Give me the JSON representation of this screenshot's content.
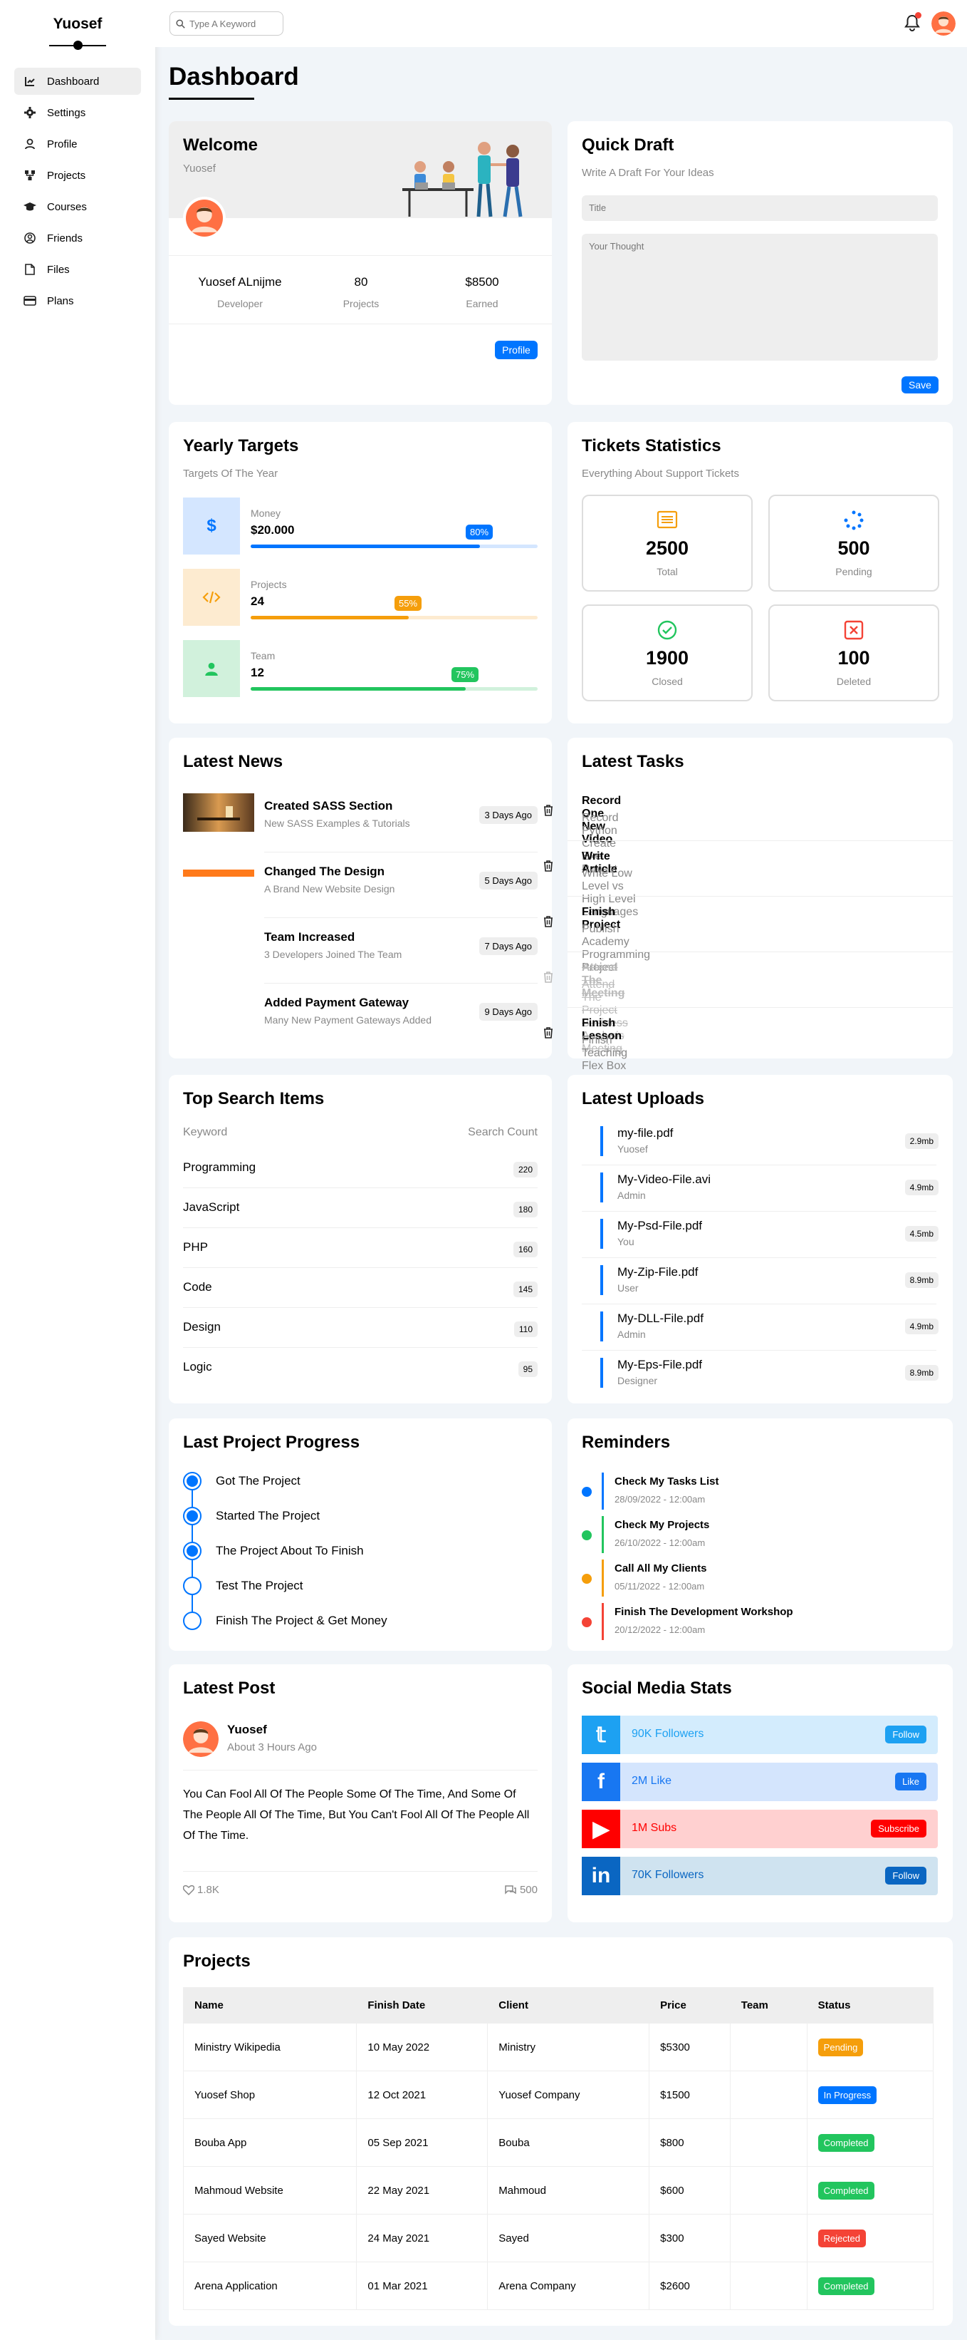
{
  "brand": "Yuosef",
  "nav": [
    {
      "label": "Dashboard",
      "icon": "chart-line-icon",
      "active": true
    },
    {
      "label": "Settings",
      "icon": "gear-icon"
    },
    {
      "label": "Profile",
      "icon": "user-icon"
    },
    {
      "label": "Projects",
      "icon": "diagram-icon"
    },
    {
      "label": "Courses",
      "icon": "graduation-cap-icon"
    },
    {
      "label": "Friends",
      "icon": "circle-user-icon"
    },
    {
      "label": "Files",
      "icon": "file-icon"
    },
    {
      "label": "Plans",
      "icon": "credit-card-icon"
    }
  ],
  "search": {
    "placeholder": "Type A Keyword"
  },
  "page_title": "Dashboard",
  "welcome": {
    "title": "Welcome",
    "name": "Yuosef",
    "stats": [
      {
        "value": "Yuosef ALnijme",
        "label": "Developer"
      },
      {
        "value": "80",
        "label": "Projects"
      },
      {
        "value": "$8500",
        "label": "Earned"
      }
    ],
    "button": "Profile"
  },
  "draft": {
    "title": "Quick Draft",
    "subtitle": "Write A Draft For Your Ideas",
    "title_placeholder": "Title",
    "body_placeholder": "Your  Thought",
    "button": "Save"
  },
  "targets": {
    "title": "Yearly Targets",
    "subtitle": "Targets Of The Year",
    "items": [
      {
        "label": "Money",
        "value": "$20.000",
        "percent": 80,
        "percent_label": "80%",
        "color": "#0075ff",
        "bg": "#d4e6ff",
        "icon": "dollar-icon"
      },
      {
        "label": "Projects",
        "value": "24",
        "percent": 55,
        "percent_label": "55%",
        "color": "#f59e0b",
        "bg": "#fdebd0",
        "icon": "code-icon"
      },
      {
        "label": "Team",
        "value": "12",
        "percent": 75,
        "percent_label": "75%",
        "color": "#22c55e",
        "bg": "#d1f1dc",
        "icon": "user-icon"
      }
    ]
  },
  "tickets": {
    "title": "Tickets Statistics",
    "subtitle": "Everything About Support Tickets",
    "items": [
      {
        "value": "2500",
        "label": "Total",
        "color": "#f59e0b",
        "icon": "list-icon"
      },
      {
        "value": "500",
        "label": "Pending",
        "color": "#0075ff",
        "icon": "spinner-icon"
      },
      {
        "value": "1900",
        "label": "Closed",
        "color": "#22c55e",
        "icon": "check-circle-icon"
      },
      {
        "value": "100",
        "label": "Deleted",
        "color": "#f44336",
        "icon": "x-square-icon"
      }
    ]
  },
  "news": {
    "title": "Latest News",
    "items": [
      {
        "title": "Created SASS Section",
        "desc": "New SASS Examples & Tutorials",
        "time": "3 Days Ago"
      },
      {
        "title": "Changed The Design",
        "desc": "A Brand New Website Design",
        "time": "5 Days Ago"
      },
      {
        "title": "Team Increased",
        "desc": "3 Developers Joined The Team",
        "time": "7 Days Ago"
      },
      {
        "title": "Added Payment Gateway",
        "desc": "Many New Payment Gateways Added",
        "time": "9 Days Ago"
      }
    ]
  },
  "tasks": {
    "title": "Latest Tasks",
    "items": [
      {
        "title": "Record One New Video",
        "desc": "Record Python Create Exe Project",
        "done": false
      },
      {
        "title": "Write Article",
        "desc": "Write Low Level vs High Level Languages",
        "done": false
      },
      {
        "title": "Finish Project",
        "desc": "Publish Academy Programming Project",
        "done": false
      },
      {
        "title": "Attend The Meeting",
        "desc": "Attend The Project Business Analysis Meeting",
        "done": true
      },
      {
        "title": "Finish Lesson",
        "desc": "Finish Teaching Flex Box",
        "done": false
      }
    ]
  },
  "top_search": {
    "title": "Top Search Items",
    "col_keyword": "Keyword",
    "col_count": "Search Count",
    "items": [
      {
        "keyword": "Programming",
        "count": "220"
      },
      {
        "keyword": "JavaScript",
        "count": "180"
      },
      {
        "keyword": "PHP",
        "count": "160"
      },
      {
        "keyword": "Code",
        "count": "145"
      },
      {
        "keyword": "Design",
        "count": "110"
      },
      {
        "keyword": "Logic",
        "count": "95"
      }
    ]
  },
  "uploads": {
    "title": "Latest Uploads",
    "items": [
      {
        "name": "my-file.pdf",
        "user": "Yuosef",
        "size": "2.9mb"
      },
      {
        "name": "My-Video-File.avi",
        "user": "Admin",
        "size": "4.9mb"
      },
      {
        "name": "My-Psd-File.pdf",
        "user": "You",
        "size": "4.5mb"
      },
      {
        "name": "My-Zip-File.pdf",
        "user": "User",
        "size": "8.9mb"
      },
      {
        "name": "My-DLL-File.pdf",
        "user": "Admin",
        "size": "4.9mb"
      },
      {
        "name": "My-Eps-File.pdf",
        "user": "Designer",
        "size": "8.9mb"
      }
    ]
  },
  "progress": {
    "title": "Last Project Progress",
    "steps": [
      {
        "label": "Got The Project",
        "done": true
      },
      {
        "label": "Started The Project",
        "done": true
      },
      {
        "label": "The Project About To Finish",
        "done": true
      },
      {
        "label": "Test The Project",
        "done": false
      },
      {
        "label": "Finish The Project & Get Money",
        "done": false
      }
    ]
  },
  "reminders": {
    "title": "Reminders",
    "items": [
      {
        "title": "Check My Tasks List",
        "date": "28/09/2022 - 12:00am",
        "color": "#0075ff"
      },
      {
        "title": "Check My Projects",
        "date": "26/10/2022 - 12:00am",
        "color": "#22c55e"
      },
      {
        "title": "Call All My Clients",
        "date": "05/11/2022 - 12:00am",
        "color": "#f59e0b"
      },
      {
        "title": "Finish The Development Workshop",
        "date": "20/12/2022 - 12:00am",
        "color": "#f44336"
      }
    ]
  },
  "post": {
    "title": "Latest Post",
    "author": "Yuosef",
    "time": "About 3 Hours Ago",
    "body": "You Can Fool All Of The People Some Of The Time, And Some Of The People All Of The Time, But You Can't Fool All Of The People All Of The Time.",
    "likes": "1.8K",
    "comments": "500"
  },
  "social": {
    "title": "Social Media Stats",
    "items": [
      {
        "text": "90K Followers",
        "button": "Follow",
        "color": "#1da1f2",
        "bg": "#d3ecfd",
        "icon": "twitter-icon",
        "glyph": "𝕥"
      },
      {
        "text": "2M Like",
        "button": "Like",
        "color": "#1877f2",
        "bg": "#d4e5fd",
        "icon": "facebook-icon",
        "glyph": "f"
      },
      {
        "text": "1M Subs",
        "button": "Subscribe",
        "color": "#ff0000",
        "bg": "#ffd0d0",
        "icon": "youtube-icon",
        "glyph": "▶"
      },
      {
        "text": "70K Followers",
        "button": "Follow",
        "color": "#0a66c2",
        "bg": "#cfe3f0",
        "icon": "linkedin-icon",
        "glyph": "in"
      }
    ]
  },
  "projects": {
    "title": "Projects",
    "headers": [
      "Name",
      "Finish Date",
      "Client",
      "Price",
      "Team",
      "Status"
    ],
    "rows": [
      {
        "name": "Ministry Wikipedia",
        "date": "10 May 2022",
        "client": "Ministry",
        "price": "$5300",
        "status": "Pending",
        "color": "#f59e0b"
      },
      {
        "name": "Yuosef Shop",
        "date": "12 Oct 2021",
        "client": "Yuosef Company",
        "price": "$1500",
        "status": "In Progress",
        "color": "#0075ff"
      },
      {
        "name": "Bouba App",
        "date": "05 Sep 2021",
        "client": "Bouba",
        "price": "$800",
        "status": "Completed",
        "color": "#22c55e"
      },
      {
        "name": "Mahmoud Website",
        "date": "22 May 2021",
        "client": "Mahmoud",
        "price": "$600",
        "status": "Completed",
        "color": "#22c55e"
      },
      {
        "name": "Sayed Website",
        "date": "24 May 2021",
        "client": "Sayed",
        "price": "$300",
        "status": "Rejected",
        "color": "#f44336"
      },
      {
        "name": "Arena Application",
        "date": "01 Mar 2021",
        "client": "Arena Company",
        "price": "$2600",
        "status": "Completed",
        "color": "#22c55e"
      }
    ]
  }
}
